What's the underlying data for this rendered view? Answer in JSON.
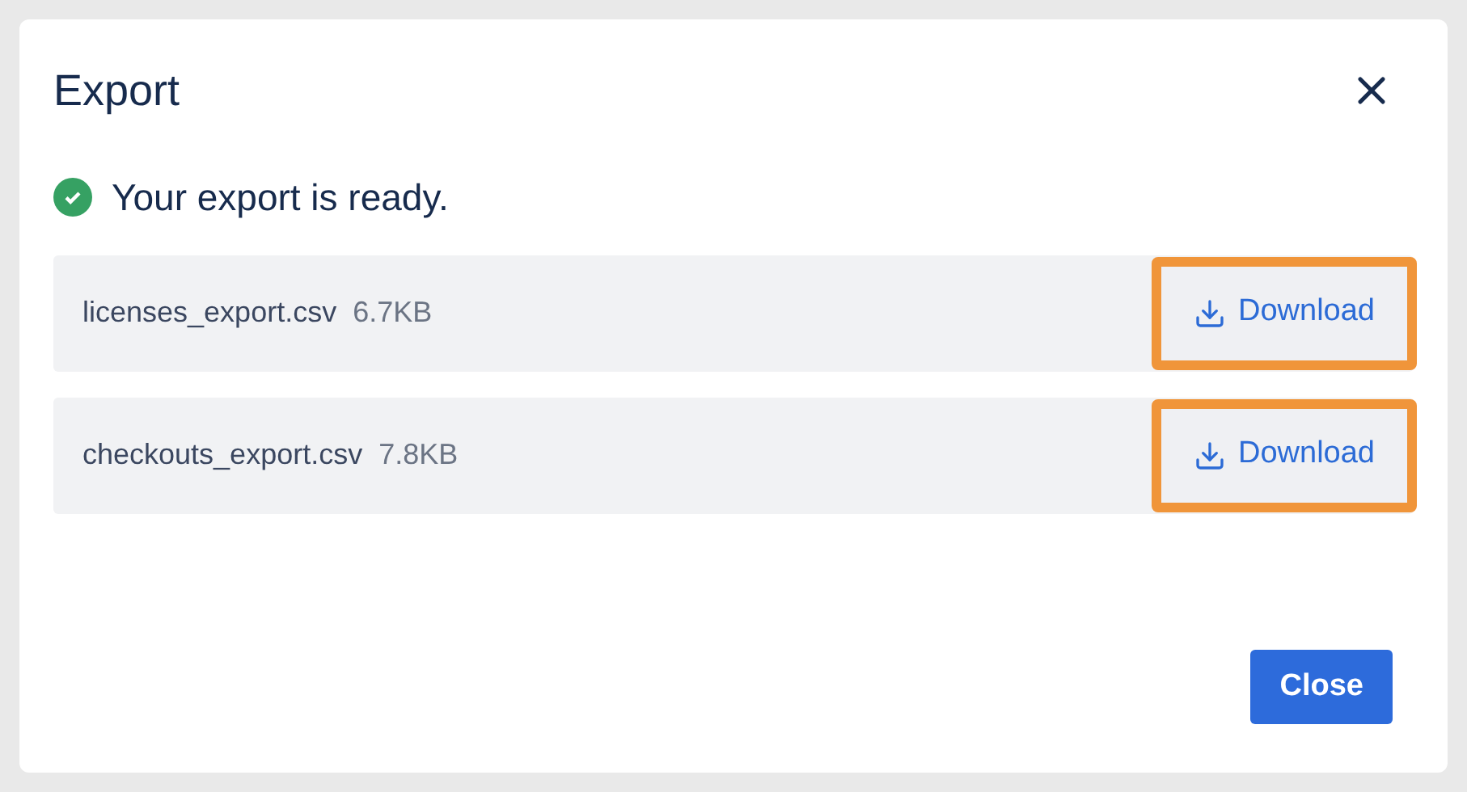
{
  "dialog": {
    "title": "Export"
  },
  "status": {
    "kind": "success",
    "message": "Your export is ready."
  },
  "files": [
    {
      "name": "licenses_export.csv",
      "size": "6.7KB",
      "action": "Download",
      "highlighted": true
    },
    {
      "name": "checkouts_export.csv",
      "size": "7.8KB",
      "action": "Download",
      "highlighted": true
    }
  ],
  "footer": {
    "button": "Close"
  }
}
